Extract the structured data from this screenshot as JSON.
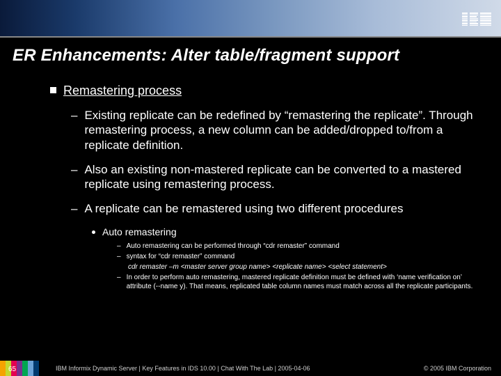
{
  "logo_name": "IBM",
  "title": "ER Enhancements: Alter table/fragment support",
  "heading": "Remastering process",
  "bullets": [
    "Existing replicate can be redefined by “remastering the replicate”. Through remastering process, a new column can be added/dropped to/from a replicate definition.",
    "Also an existing non-mastered replicate can be converted to a mastered replicate using remastering process.",
    "A replicate can be remastered using two different procedures"
  ],
  "sub_heading": "Auto remastering",
  "sub_items": [
    "Auto remastering can be performed through “cdr remaster” command",
    "syntax for “cdr remaster” command"
  ],
  "command_line": "cdr remaster –m <master server group name> <replicate name>  <select statement>",
  "sub_item_after": "In order to perform auto remastering, mastered replicate definition must be defined with ‘name verification on’ attribute (--name y). That means, replicated table column names must match across all the replicate participants.",
  "slide_number": "65",
  "footer_text": "IBM Informix Dynamic Server  |  Key Features in IDS 10.00  |  Chat With The Lab  |  2005-04-06",
  "copyright": "© 2005 IBM Corporation",
  "colorbars": [
    "#f5a300",
    "#c4d82e",
    "#e40050",
    "#7a2e8f",
    "#00a651",
    "#6aa2d8",
    "#003a70"
  ]
}
